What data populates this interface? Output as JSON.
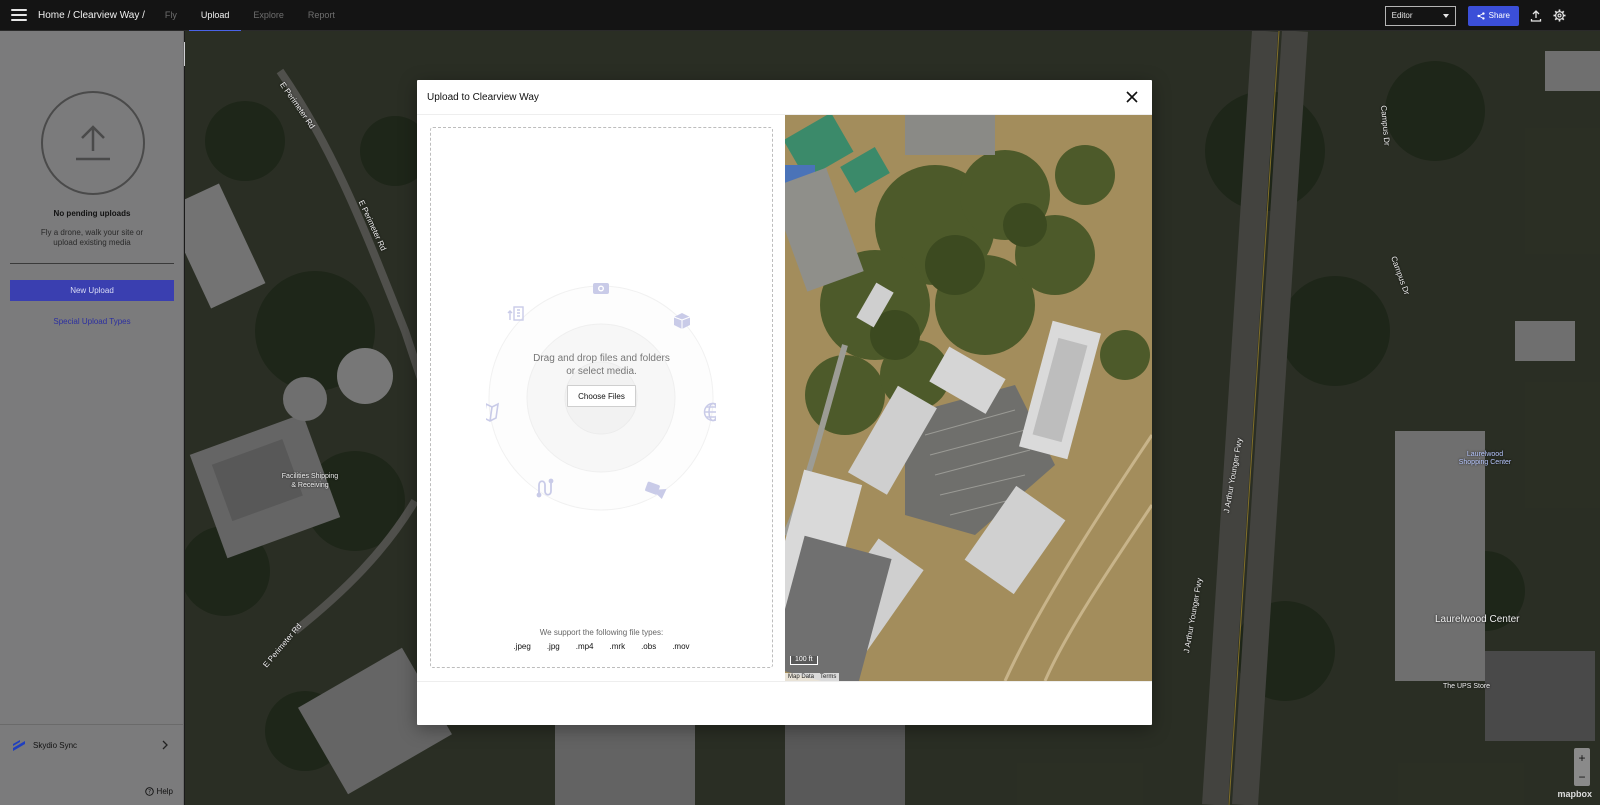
{
  "topbar": {
    "breadcrumb": "Home / Clearview Way /",
    "tabs": [
      {
        "label": "Fly",
        "active": false
      },
      {
        "label": "Upload",
        "active": true
      },
      {
        "label": "Explore",
        "active": false
      },
      {
        "label": "Report",
        "active": false
      }
    ],
    "role_select": "Editor",
    "share_label": "Share",
    "icons": [
      "menu-icon",
      "share-icon",
      "export-icon",
      "settings-icon"
    ]
  },
  "sidebar": {
    "no_pending_title": "No pending uploads",
    "no_pending_sub": "Fly a drone, walk your site or upload existing media",
    "new_upload_label": "New Upload",
    "special_upload_label": "Special Upload Types",
    "sync_label": "Skydio Sync",
    "help_label": "Help"
  },
  "modal": {
    "title": "Upload to Clearview Way",
    "drag_text_1": "Drag and drop files and folders",
    "drag_text_2": "or select media.",
    "choose_files_label": "Choose Files",
    "support_text": "We support the following file types:",
    "file_types": [
      ".jpeg",
      ".jpg",
      ".mp4",
      ".mrk",
      ".obs",
      ".mov"
    ],
    "map_scale": "100 ft",
    "map_attrib_1": "Map Data",
    "map_attrib_2": "Terms"
  },
  "background_map": {
    "labels": [
      "E Perimeter Rd",
      "E Perimeter Rd",
      "E Perimeter Rd",
      "Facilities Shipping & Receiving",
      "J Arthur Younger Fwy",
      "J Arthur Younger Fwy",
      "Campus Dr",
      "Campus Dr",
      "Laurelwood Shopping Center",
      "Laurelwood Center",
      "The UPS Store",
      "mapbox"
    ]
  },
  "colors": {
    "accent": "#3b4fd8",
    "sidebar_button": "#3a3fb0",
    "topbar": "#141414"
  }
}
